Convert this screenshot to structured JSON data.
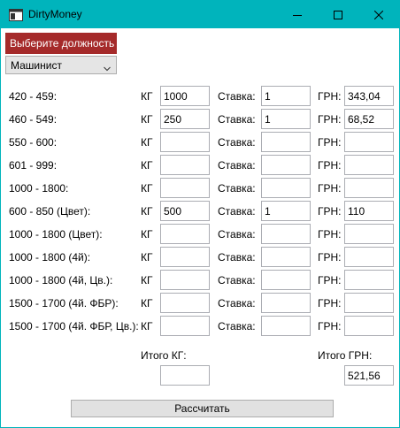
{
  "window": {
    "title": "DirtyMoney",
    "minimize_icon": "minimize-icon",
    "maximize_icon": "maximize-icon",
    "close_icon": "close-icon"
  },
  "role": {
    "label": "Выберите должность",
    "selected": "Машинист",
    "label_bg": "#a52a2a"
  },
  "labels": {
    "kg": "КГ",
    "rate": "Ставка:",
    "grn": "ГРН:"
  },
  "rows": [
    {
      "range": "420 - 459:",
      "kg": "1000",
      "rate": "1",
      "grn": "343,04"
    },
    {
      "range": "460 - 549:",
      "kg": "250",
      "rate": "1",
      "grn": "68,52"
    },
    {
      "range": "550 - 600:",
      "kg": "",
      "rate": "",
      "grn": ""
    },
    {
      "range": "601 - 999:",
      "kg": "",
      "rate": "",
      "grn": ""
    },
    {
      "range": "1000 - 1800:",
      "kg": "",
      "rate": "",
      "grn": ""
    },
    {
      "range": "600 - 850 (Цвет):",
      "kg": "500",
      "rate": "1",
      "grn": "110"
    },
    {
      "range": "1000 - 1800 (Цвет):",
      "kg": "",
      "rate": "",
      "grn": ""
    },
    {
      "range": "1000 - 1800 (4й):",
      "kg": "",
      "rate": "",
      "grn": ""
    },
    {
      "range": "1000 - 1800 (4й, Цв.):",
      "kg": "",
      "rate": "",
      "grn": ""
    },
    {
      "range": "1500 - 1700 (4й. ФБР):",
      "kg": "",
      "rate": "",
      "grn": ""
    },
    {
      "range": "1500 - 1700 (4й. ФБР, Цв.):",
      "kg": "",
      "rate": "",
      "grn": ""
    }
  ],
  "totals": {
    "kg_label": "Итого КГ:",
    "kg_value": "",
    "grn_label": "Итого ГРН:",
    "grn_value": "521,56"
  },
  "calculate_label": "Рассчитать",
  "colors": {
    "titlebar": "#00b4bc"
  }
}
